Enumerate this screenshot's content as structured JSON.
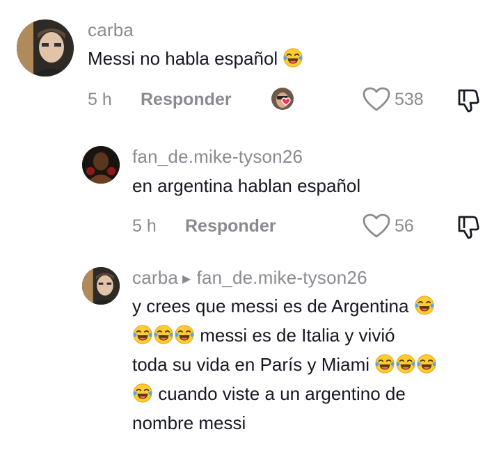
{
  "comments": [
    {
      "username": "carba",
      "text": "Messi no habla español",
      "time": "5 h",
      "reply_label": "Responder",
      "likes": "538",
      "avatar_icon": "user-avatar-carba",
      "liked_by_creator": true
    },
    {
      "username": "fan_de.mike-tyson26",
      "text": "en argentina hablan español",
      "time": "5 h",
      "reply_label": "Responder",
      "likes": "56",
      "avatar_icon": "user-avatar-boxer"
    },
    {
      "username": "carba",
      "reply_to": "fan_de.mike-tyson26",
      "lines": [
        "y crees que messi es de Argentina",
        "messi es de Italia y vivió",
        "toda su vida en París y Miami",
        "cuando viste a un argentino de",
        "nombre messi"
      ],
      "avatar_icon": "user-avatar-carba"
    }
  ],
  "colors": {
    "text": "#161823",
    "secondary": "#8a8b91",
    "heart_badge": "#fe2c55"
  }
}
